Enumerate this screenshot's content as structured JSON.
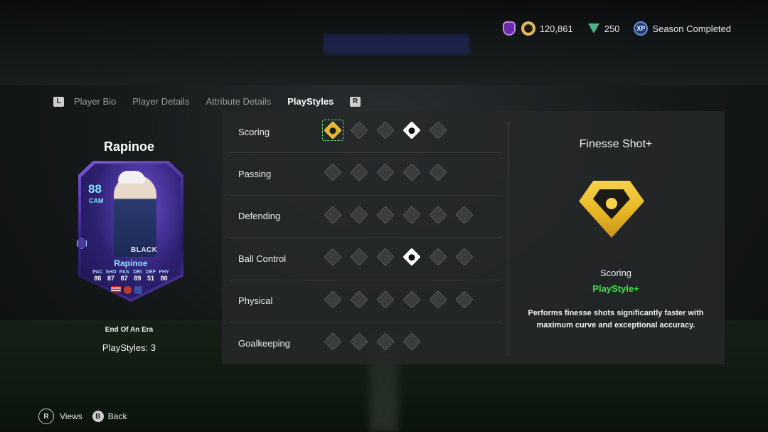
{
  "topbar": {
    "coins": "120,861",
    "points": "250",
    "xp_status": "Season Completed",
    "xp_icon_text": "XP"
  },
  "tabs": {
    "left_key": "L",
    "right_key": "R",
    "items": [
      {
        "label": "Player Bio",
        "active": false
      },
      {
        "label": "Player Details",
        "active": false
      },
      {
        "label": "Attribute Details",
        "active": false
      },
      {
        "label": "PlayStyles",
        "active": true
      }
    ]
  },
  "player": {
    "name": "Rapinoe",
    "card": {
      "overall": "88",
      "position": "CAM",
      "club_text": "BLACK",
      "card_name": "Rapinoe",
      "stat_labels": [
        "PAC",
        "SHO",
        "PAS",
        "DRI",
        "DEF",
        "PHY"
      ],
      "stat_values": [
        "86",
        "87",
        "87",
        "89",
        "51",
        "80"
      ]
    },
    "card_subtitle": "End Of An Era",
    "playstyles_count": "PlayStyles: 3"
  },
  "categories": [
    {
      "label": "Scoring",
      "icons": 5
    },
    {
      "label": "Passing",
      "icons": 5
    },
    {
      "label": "Defending",
      "icons": 6
    },
    {
      "label": "Ball Control",
      "icons": 6
    },
    {
      "label": "Physical",
      "icons": 6
    },
    {
      "label": "Goalkeeping",
      "icons": 4
    }
  ],
  "detail": {
    "title": "Finesse Shot+",
    "category": "Scoring",
    "tier": "PlayStyle+",
    "description": "Performs finesse shots significantly faster with maximum curve and exceptional accuracy."
  },
  "controls": {
    "views_key": "R",
    "views_label": "Views",
    "back_key": "B",
    "back_label": "Back"
  },
  "colors": {
    "accent_green": "#3fe04a",
    "gold": "#e7b622",
    "panel": "#262a2c"
  }
}
